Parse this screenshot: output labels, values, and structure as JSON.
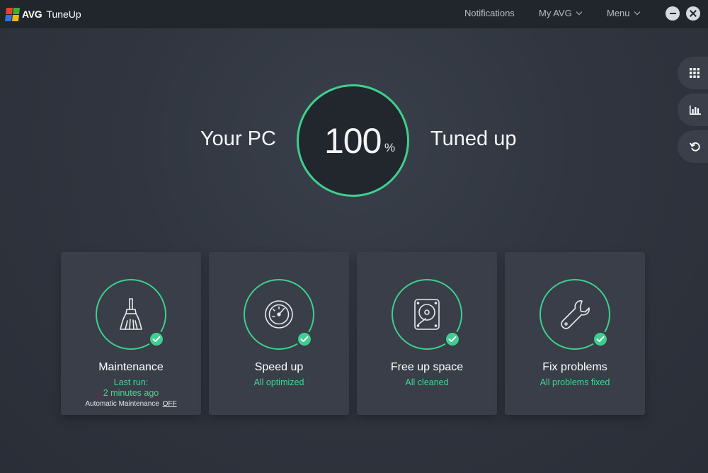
{
  "app": {
    "brand": "AVG",
    "product": "TuneUp",
    "logo_colors": [
      "#e8412b",
      "#3fae3a",
      "#2a79d6",
      "#f1b90f"
    ]
  },
  "topbar": {
    "notifications_label": "Notifications",
    "my_avg_label": "My AVG",
    "menu_label": "Menu"
  },
  "hero": {
    "left_text": "Your PC",
    "score": "100",
    "unit": "%",
    "right_text": "Tuned up"
  },
  "sidebar_icons": [
    "grid-icon",
    "bar-chart-icon",
    "undo-icon"
  ],
  "cards": [
    {
      "icon": "broom-icon",
      "title": "Maintenance",
      "status_line1": "Last run:",
      "status_line2": "2 minutes ago",
      "note_label": "Automatic Maintenance",
      "note_value": "OFF"
    },
    {
      "icon": "speedometer-icon",
      "title": "Speed up",
      "status": "All optimized"
    },
    {
      "icon": "hard-drive-icon",
      "title": "Free up space",
      "status": "All cleaned"
    },
    {
      "icon": "wrench-icon",
      "title": "Fix problems",
      "status": "All problems fixed"
    }
  ],
  "colors": {
    "accent": "#3ecf8e",
    "background": "#30353f",
    "card": "#393e48",
    "topbar": "#21252c"
  }
}
